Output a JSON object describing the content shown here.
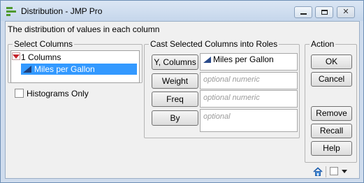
{
  "window": {
    "title": "Distribution - JMP Pro",
    "description": "The distribution of values in each column"
  },
  "select_columns": {
    "title": "Select Columns",
    "count_label": "1 Columns",
    "items": [
      {
        "label": "Miles per Gallon",
        "selected": true,
        "icon": "continuous-column-icon"
      }
    ],
    "histograms_only_label": "Histograms Only",
    "histograms_only_checked": false
  },
  "cast_roles": {
    "title": "Cast Selected Columns into Roles",
    "roles": [
      {
        "button": "Y, Columns",
        "value": "Miles per Gallon",
        "placeholder": ""
      },
      {
        "button": "Weight",
        "value": "",
        "placeholder": "optional numeric"
      },
      {
        "button": "Freq",
        "value": "",
        "placeholder": "optional numeric"
      },
      {
        "button": "By",
        "value": "",
        "placeholder": "optional"
      }
    ]
  },
  "action": {
    "title": "Action",
    "ok": "OK",
    "cancel": "Cancel",
    "remove": "Remove",
    "recall": "Recall",
    "help": "Help"
  },
  "colors": {
    "selection": "#3399ff",
    "disclosure_red": "#c4222a",
    "jmp_green": "#4f9a2e",
    "window_frame": "#cfdced"
  }
}
